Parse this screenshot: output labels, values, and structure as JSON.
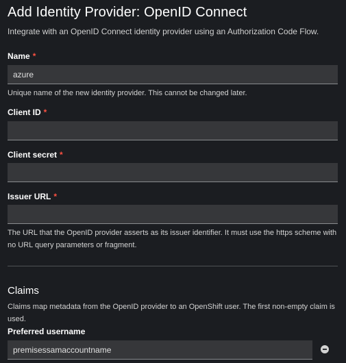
{
  "header": {
    "title": "Add Identity Provider: OpenID Connect",
    "subtitle": "Integrate with an OpenID Connect identity provider using an Authorization Code Flow."
  },
  "form": {
    "required_marker": "*",
    "name": {
      "label": "Name",
      "value": "azure",
      "help": "Unique name of the new identity provider. This cannot be changed later."
    },
    "client_id": {
      "label": "Client ID",
      "value": ""
    },
    "client_secret": {
      "label": "Client secret",
      "value": ""
    },
    "issuer_url": {
      "label": "Issuer URL",
      "value": "",
      "help": "The URL that the OpenID provider asserts as its issuer identifier. It must use the https scheme with no URL query parameters or fragment."
    }
  },
  "claims": {
    "title": "Claims",
    "description": "Claims map metadata from the OpenID provider to an OpenShift user. The first non-empty claim is used.",
    "preferred_username": {
      "label": "Preferred username",
      "value": "premisessamaccountname"
    },
    "remove_icon": "minus-circle-icon"
  },
  "colors": {
    "background": "#1b1d21",
    "input_background": "#36373a",
    "required": "#fe5142",
    "divider": "#4f5255"
  }
}
